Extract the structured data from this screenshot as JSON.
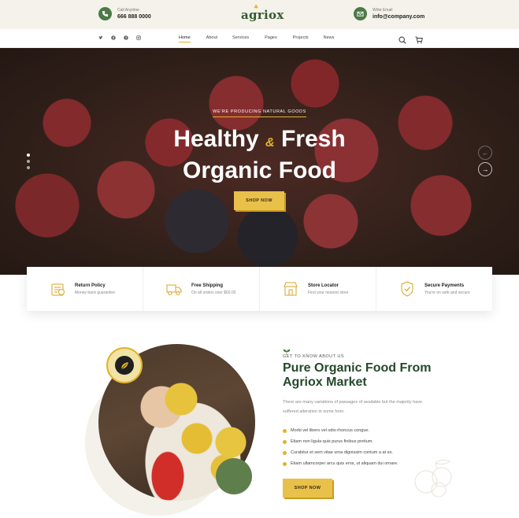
{
  "topbar": {
    "phone_label": "Call Anytime",
    "phone": "666 888 0000",
    "email_label": "Write Email",
    "email": "info@company.com",
    "logo": "agriox",
    "phone_icon": "phone-icon",
    "email_icon": "mail-icon"
  },
  "nav": {
    "social": [
      "twitter-icon",
      "facebook-icon",
      "pinterest-icon",
      "instagram-icon"
    ],
    "items": [
      {
        "label": "Home",
        "active": true
      },
      {
        "label": "About"
      },
      {
        "label": "Services"
      },
      {
        "label": "Pages"
      },
      {
        "label": "Projects"
      },
      {
        "label": "News"
      }
    ],
    "icons": [
      "search-icon",
      "cart-icon"
    ]
  },
  "hero": {
    "eyebrow": "WE'RE PRODUCING NATURAL GOODS",
    "title_line1a": "Healthy",
    "title_amp": "&",
    "title_line1b": "Fresh",
    "title_line2": "Organic Food",
    "button": "SHOP NOW",
    "prev_arrow": "←",
    "next_arrow": "→"
  },
  "features": [
    {
      "title": "Return Policy",
      "subtitle": "Money back guarantee",
      "icon": "return-icon"
    },
    {
      "title": "Free Shipping",
      "subtitle": "On all orders over $60.00",
      "icon": "truck-icon"
    },
    {
      "title": "Store Locator",
      "subtitle": "Find your nearest store",
      "icon": "store-icon"
    },
    {
      "title": "Secure Payments",
      "subtitle": "You're on safe and secure",
      "icon": "shield-icon"
    }
  ],
  "about": {
    "eyebrow": "GET TO KNOW ABOUT US",
    "title": "Pure Organic Food From Agriox Market",
    "text": "There are many variations of passages of available but the majority have suffered alteration in some form.",
    "checks": [
      "Morbi vel libero vel odio rhoncus congue.",
      "Etiam non ligula quis purus finibus pretium.",
      "Curabitur et sem vitae urna dignissim contum a at ex.",
      "Etiam ullamcorper arcu quis eros, ut aliquam dui ornare."
    ],
    "button": "SHOP NOW"
  },
  "colors": {
    "accent": "#e8c04a",
    "brand_green": "#24492a",
    "topbar_bg": "#f4f2ea"
  }
}
